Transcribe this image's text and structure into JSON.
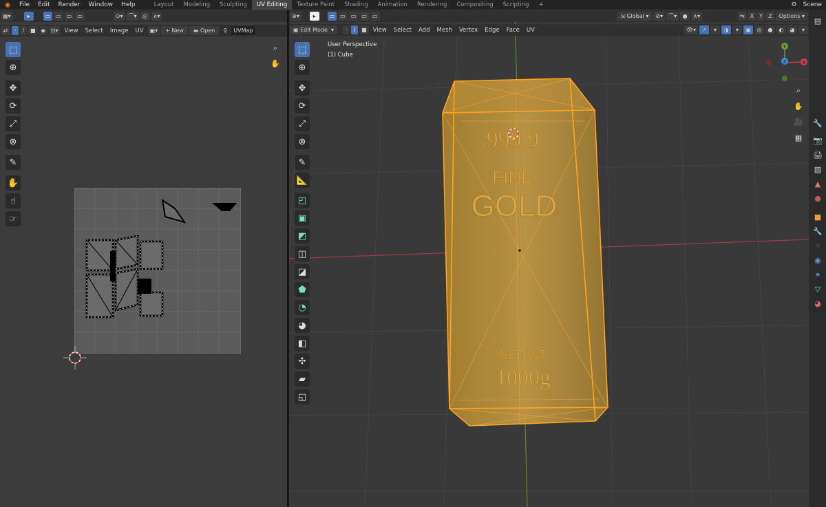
{
  "topbar": {
    "menus": [
      "File",
      "Edit",
      "Render",
      "Window",
      "Help"
    ],
    "workspaces": [
      "Layout",
      "Modeling",
      "Sculpting",
      "UV Editing",
      "Texture Paint",
      "Shading",
      "Animation",
      "Rendering",
      "Compositing",
      "Scripting"
    ],
    "active_workspace": "UV Editing",
    "add_tab": "+",
    "scene": "Scene"
  },
  "uv_editor": {
    "header": {
      "view": "View",
      "select": "Select",
      "image": "Image",
      "uv": "UV",
      "new": "New",
      "open": "Open",
      "uvmap": "UVMap"
    }
  },
  "viewport": {
    "header": {
      "mode": "Edit Mode",
      "view": "View",
      "select": "Select",
      "add": "Add",
      "mesh": "Mesh",
      "vertex": "Vertex",
      "edge": "Edge",
      "face": "Face",
      "uv": "UV",
      "orientation": "Global",
      "options": "Options"
    },
    "overlay": {
      "perspective": "User Perspective",
      "object": "(1) Cube"
    },
    "axes": {
      "x": "X",
      "y": "Y",
      "z": "Z"
    },
    "bar_text": {
      "purity": "999.9",
      "line1": "FINE",
      "line2": "GOLD",
      "weight_label": "NET WT",
      "weight": "1000g"
    }
  },
  "colors": {
    "accent": "#4772b3",
    "selection": "#ffa41f",
    "gold": "#c8841c",
    "x_axis": "#c94250",
    "y_axis": "#6d9b2f",
    "z_axis": "#3b8de0"
  },
  "icons": [
    "blender-logo",
    "cursor-icon",
    "move-icon",
    "rotate-icon",
    "scale-icon",
    "transform-icon",
    "annotate-icon",
    "measure-icon",
    "extrude-icon",
    "inset-icon",
    "bevel-icon",
    "loopcut-icon",
    "knife-icon",
    "polybuild-icon",
    "spin-icon",
    "smooth-icon",
    "slide-icon",
    "shrink-icon",
    "shear-icon",
    "rip-icon",
    "zoom-icon",
    "hand-icon",
    "camera-icon",
    "grid-icon",
    "tool-settings-icon",
    "render-icon",
    "output-icon",
    "view-layer-icon",
    "scene-icon",
    "world-icon",
    "object-icon",
    "modifier-icon",
    "particles-icon",
    "physics-icon",
    "constraints-icon",
    "data-icon",
    "material-icon"
  ]
}
